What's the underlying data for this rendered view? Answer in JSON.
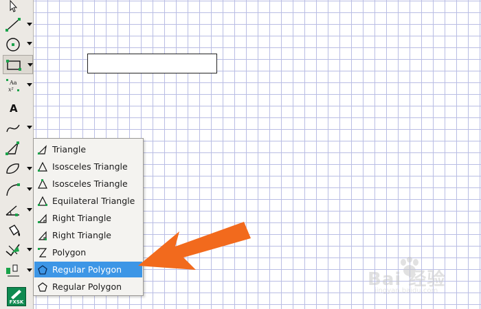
{
  "toolbar": {
    "tools": [
      {
        "icon": "arrow-select-icon",
        "selected": false
      },
      {
        "icon": "line-tool-icon",
        "selected": false
      },
      {
        "icon": "circle-tool-icon",
        "selected": false
      },
      {
        "icon": "rectangle-tool-icon",
        "selected": true
      },
      {
        "icon": "text-formula-icon",
        "selected": false
      },
      {
        "icon": "text-tool-icon",
        "selected": false
      },
      {
        "icon": "curve-tool-icon",
        "selected": false
      },
      {
        "icon": "triangle-tool-icon",
        "selected": false
      },
      {
        "icon": "ellipse-tool-icon",
        "selected": false
      },
      {
        "icon": "arc-tool-icon",
        "selected": false
      },
      {
        "icon": "angle-tool-icon",
        "selected": false
      },
      {
        "icon": "fill-tool-icon",
        "selected": false
      },
      {
        "icon": "check-tool-icon",
        "selected": false
      },
      {
        "icon": "transform-tool-icon",
        "selected": false
      }
    ],
    "logo_text": "FXSK"
  },
  "menu": {
    "items": [
      {
        "label": "Triangle",
        "icon": "triangle-icon",
        "highlighted": false
      },
      {
        "label": "Isosceles Triangle",
        "icon": "isosceles-triangle-icon",
        "highlighted": false
      },
      {
        "label": "Isosceles Triangle",
        "icon": "isosceles-triangle-icon",
        "highlighted": false
      },
      {
        "label": "Equilateral Triangle",
        "icon": "equilateral-triangle-icon",
        "highlighted": false
      },
      {
        "label": "Right Triangle",
        "icon": "right-triangle-icon",
        "highlighted": false
      },
      {
        "label": "Right Triangle",
        "icon": "right-triangle-icon",
        "highlighted": false
      },
      {
        "label": "Polygon",
        "icon": "polygon-icon",
        "highlighted": false
      },
      {
        "label": "Regular Polygon",
        "icon": "regular-polygon-icon",
        "highlighted": true
      },
      {
        "label": "Regular Polygon",
        "icon": "regular-polygon-icon",
        "highlighted": false
      }
    ]
  },
  "watermark": {
    "brand": "Bai  经验",
    "url": "jingyan.baidu.com"
  },
  "colors": {
    "highlight": "#3d96e6",
    "pointer_arrow": "#f26a1d",
    "grid": "#b9bde4",
    "point_green": "#1aa34a"
  }
}
